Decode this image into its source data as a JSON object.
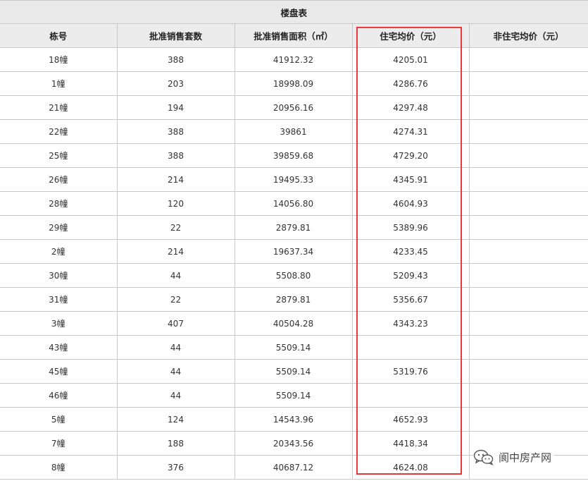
{
  "table": {
    "title": "楼盘表",
    "headers": [
      "栋号",
      "批准销售套数",
      "批准销售面积（㎡）",
      "住宅均价（元）",
      "非住宅均价（元）"
    ],
    "rows": [
      [
        "18幢",
        "388",
        "41912.32",
        "4205.01",
        ""
      ],
      [
        "1幢",
        "203",
        "18998.09",
        "4286.76",
        ""
      ],
      [
        "21幢",
        "194",
        "20956.16",
        "4297.48",
        ""
      ],
      [
        "22幢",
        "388",
        "39861",
        "4274.31",
        ""
      ],
      [
        "25幢",
        "388",
        "39859.68",
        "4729.20",
        ""
      ],
      [
        "26幢",
        "214",
        "19495.33",
        "4345.91",
        ""
      ],
      [
        "28幢",
        "120",
        "14056.80",
        "4604.93",
        ""
      ],
      [
        "29幢",
        "22",
        "2879.81",
        "5389.96",
        ""
      ],
      [
        "2幢",
        "214",
        "19637.34",
        "4233.45",
        ""
      ],
      [
        "30幢",
        "44",
        "5508.80",
        "5209.43",
        ""
      ],
      [
        "31幢",
        "22",
        "2879.81",
        "5356.67",
        ""
      ],
      [
        "3幢",
        "407",
        "40504.28",
        "4343.23",
        ""
      ],
      [
        "43幢",
        "44",
        "5509.14",
        "",
        ""
      ],
      [
        "45幢",
        "44",
        "5509.14",
        "5319.76",
        ""
      ],
      [
        "46幢",
        "44",
        "5509.14",
        "",
        ""
      ],
      [
        "5幢",
        "124",
        "14543.96",
        "4652.93",
        ""
      ],
      [
        "7幢",
        "188",
        "20343.56",
        "4418.34",
        ""
      ],
      [
        "8幢",
        "376",
        "40687.12",
        "4624.08",
        ""
      ]
    ]
  },
  "highlight": {
    "column": "住宅均价（元）",
    "color": "#e8383d"
  },
  "watermark": {
    "text": "阆中房产网",
    "icon": "wechat-icon"
  }
}
